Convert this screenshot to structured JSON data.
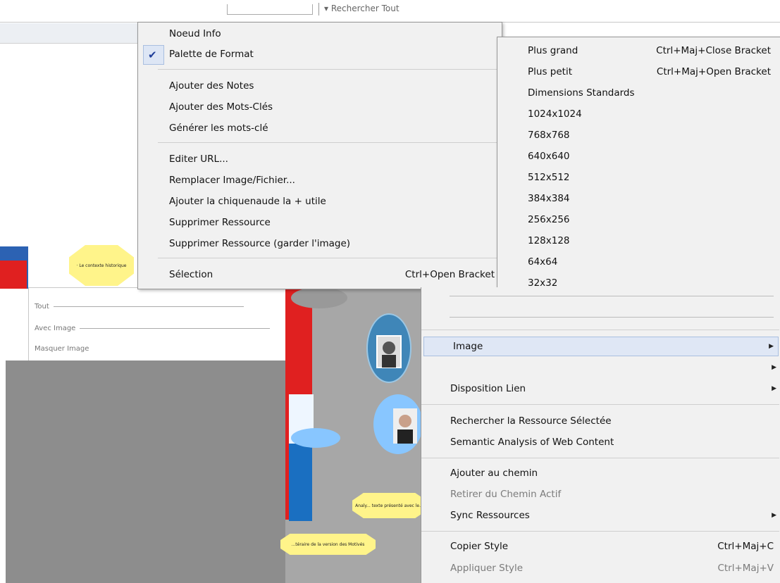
{
  "toolbar": {
    "search_label": "▾ Rechercher Tout"
  },
  "canvas": {
    "octagon1_text": "· Le contexte historique",
    "octagon2_text": "Analy... texte présenté avec le...",
    "octagon3_text": "...téraire de la version des Motivés"
  },
  "thumb_panel": {
    "rows": [
      "Tout",
      "Avec Image",
      "Masquer Image"
    ]
  },
  "main_menu": {
    "items": [
      {
        "label": "Noeud Info"
      },
      {
        "label": "Palette de Format",
        "checked": true
      },
      {
        "label": "Ajouter des Notes"
      },
      {
        "label": "Ajouter des Mots-Clés"
      },
      {
        "label": "Générer les mots-clé"
      },
      {
        "label": "Editer URL..."
      },
      {
        "label": "Remplacer Image/Fichier..."
      },
      {
        "label": "Ajouter la chiquenaude la + utile"
      },
      {
        "label": "Supprimer Ressource"
      },
      {
        "label": "Supprimer Ressource (garder l'image)"
      },
      {
        "label": "Sélection",
        "shortcut": "Ctrl+Open Bracket"
      }
    ]
  },
  "size_menu": {
    "items": [
      {
        "label": "Plus grand",
        "shortcut": "Ctrl+Maj+Close Bracket"
      },
      {
        "label": "Plus petit",
        "shortcut": "Ctrl+Maj+Open Bracket"
      },
      {
        "label": "Dimensions Standards"
      },
      {
        "label": "1024x1024"
      },
      {
        "label": "768x768"
      },
      {
        "label": "640x640"
      },
      {
        "label": "512x512"
      },
      {
        "label": "384x384"
      },
      {
        "label": "256x256"
      },
      {
        "label": "128x128"
      },
      {
        "label": "64x64"
      },
      {
        "label": "32x32"
      }
    ]
  },
  "context_menu": {
    "items": [
      {
        "label": "Image",
        "submenu": true,
        "highlighted": true
      },
      {
        "label": "Disposition Lien",
        "submenu": true
      },
      {
        "label": "Rechercher la Ressource Sélectée"
      },
      {
        "label": "Semantic Analysis of Web Content"
      },
      {
        "label": "Ajouter au chemin"
      },
      {
        "label": "Retirer du Chemin Actif",
        "disabled": true
      },
      {
        "label": "Sync Ressources",
        "submenu": true
      },
      {
        "label": "Copier Style",
        "shortcut": "Ctrl+Maj+C"
      },
      {
        "label": "Appliquer Style",
        "shortcut": "Ctrl+Maj+V",
        "disabled": true
      }
    ]
  },
  "icons": {
    "check": "check-icon",
    "submenu_arrow": "triangle-right-icon"
  },
  "colors": {
    "menu_bg": "#f1f1f1",
    "highlight": "#dfe7f5",
    "check": "#1f3f9a",
    "node_yellow": "#fff48a",
    "node_blue": "#88c6ff",
    "canvas_red": "#e02020"
  }
}
